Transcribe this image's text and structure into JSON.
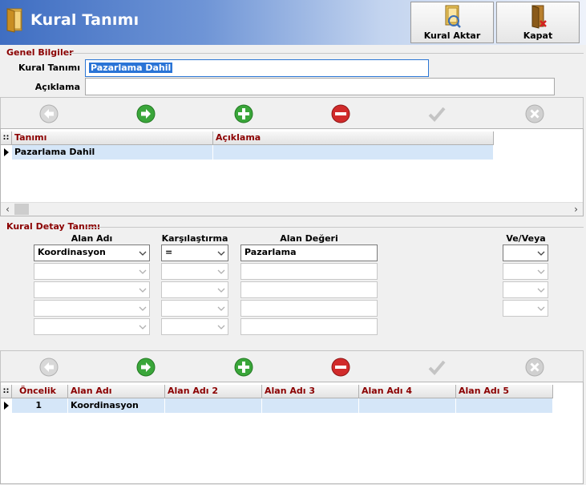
{
  "header": {
    "title": "Kural Tanımı",
    "buttons": [
      {
        "label": "Kural Aktar",
        "icon": "export-rule-icon"
      },
      {
        "label": "Kapat",
        "icon": "close-door-icon"
      }
    ]
  },
  "genel": {
    "group_title": "Genel Bilgiler",
    "kural_tanimi_label": "Kural Tanımı",
    "kural_tanimi_value": "Pazarlama Dahil",
    "aciklama_label": "Açıklama",
    "aciklama_value": ""
  },
  "nav_icons": [
    "back-arrow-icon",
    "forward-arrow-icon",
    "add-icon",
    "delete-icon",
    "confirm-check-icon",
    "cancel-icon"
  ],
  "rules_grid": {
    "columns": [
      "Tanımı",
      "Açıklama"
    ],
    "rows": [
      {
        "tanimi": "Pazarlama Dahil",
        "aciklama": ""
      }
    ]
  },
  "detail": {
    "group_title": "Kural Detay Tanımı",
    "headers": {
      "alan_adi": "Alan Adı",
      "karsilastirma": "Karşılaştırma",
      "alan_degeri": "Alan Değeri",
      "ve_veya": "Ve/Veya"
    },
    "rows": [
      {
        "alan_adi": "Koordinasyon",
        "karsilastirma": "=",
        "alan_degeri": "Pazarlama",
        "ve_veya": ""
      },
      {
        "alan_adi": "",
        "karsilastirma": "",
        "alan_degeri": "",
        "ve_veya": ""
      },
      {
        "alan_adi": "",
        "karsilastirma": "",
        "alan_degeri": "",
        "ve_veya": ""
      },
      {
        "alan_adi": "",
        "karsilastirma": "",
        "alan_degeri": "",
        "ve_veya": ""
      },
      {
        "alan_adi": "",
        "karsilastirma": "",
        "alan_degeri": ""
      }
    ]
  },
  "detail_grid": {
    "columns": [
      "Öncelik",
      "Alan Adı",
      "Alan Adı 2",
      "Alan Adı 3",
      "Alan Adı 4",
      "Alan Adı 5"
    ],
    "rows": [
      {
        "oncelik": "1",
        "alan_adi": "Koordinasyon",
        "alan_adi_2": "",
        "alan_adi_3": "",
        "alan_adi_4": "",
        "alan_adi_5": ""
      }
    ]
  },
  "colors": {
    "header_gradient_start": "#3f6ec2",
    "group_label": "#8b0000",
    "selection_row": "#d5e6f8",
    "selected_text_bg": "#2a74d6",
    "add_green": "#3aa63a",
    "delete_red": "#d12b2b"
  }
}
